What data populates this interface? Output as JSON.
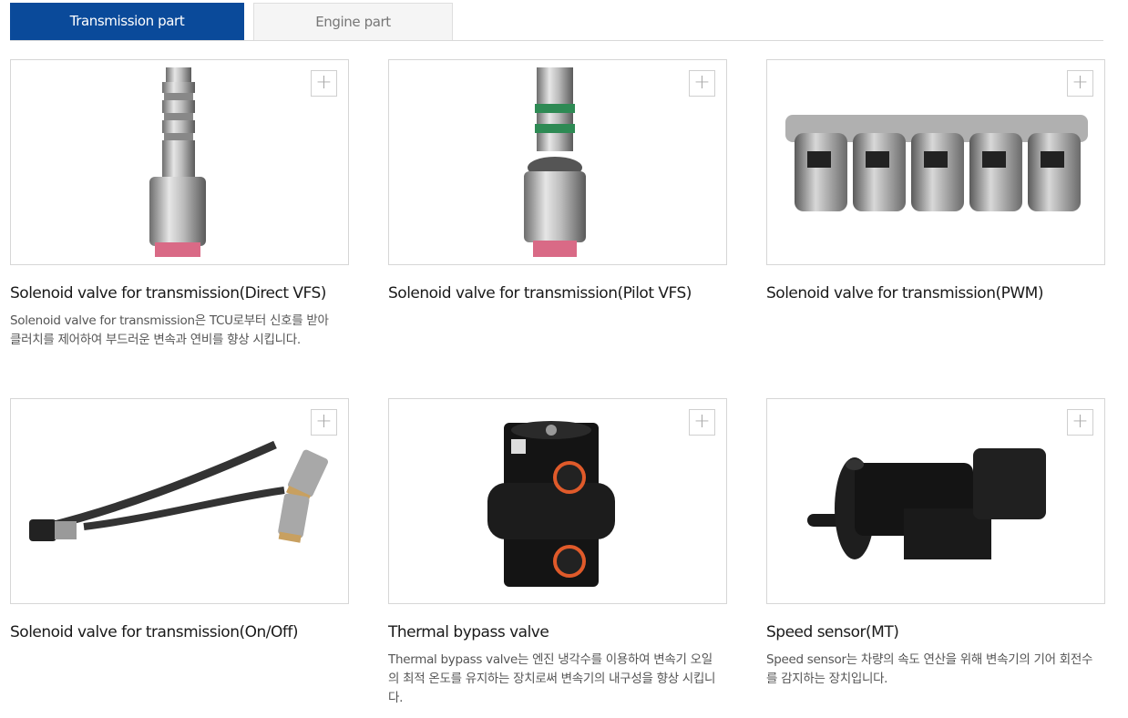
{
  "tabs": {
    "active": "Transmission part",
    "inactive": "Engine part"
  },
  "plus_symbol": "+",
  "products": [
    {
      "title": "Solenoid valve for transmission(Direct VFS)",
      "desc": "Solenoid valve for transmission은 TCU로부터 신호를 받아 클러치를 제어하여 부드러운 변속과 연비를 향상 시킵니다."
    },
    {
      "title": "Solenoid valve for transmission(Pilot VFS)",
      "desc": ""
    },
    {
      "title": "Solenoid valve for transmission(PWM)",
      "desc": ""
    },
    {
      "title": "Solenoid valve for transmission(On/Off)",
      "desc": ""
    },
    {
      "title": "Thermal bypass valve",
      "desc": "Thermal bypass valve는 엔진 냉각수를 이용하여 변속기 오일의 최적 온도를 유지하는 장치로써 변속기의 내구성을 향상 시킵니다."
    },
    {
      "title": "Speed sensor(MT)",
      "desc": "Speed sensor는 차량의 속도 연산을 위해 변속기의 기어 회전수를 감지하는 장치입니다."
    }
  ],
  "colors": {
    "tab_active_bg": "#0a4a9a",
    "border": "#d6d6d6"
  }
}
